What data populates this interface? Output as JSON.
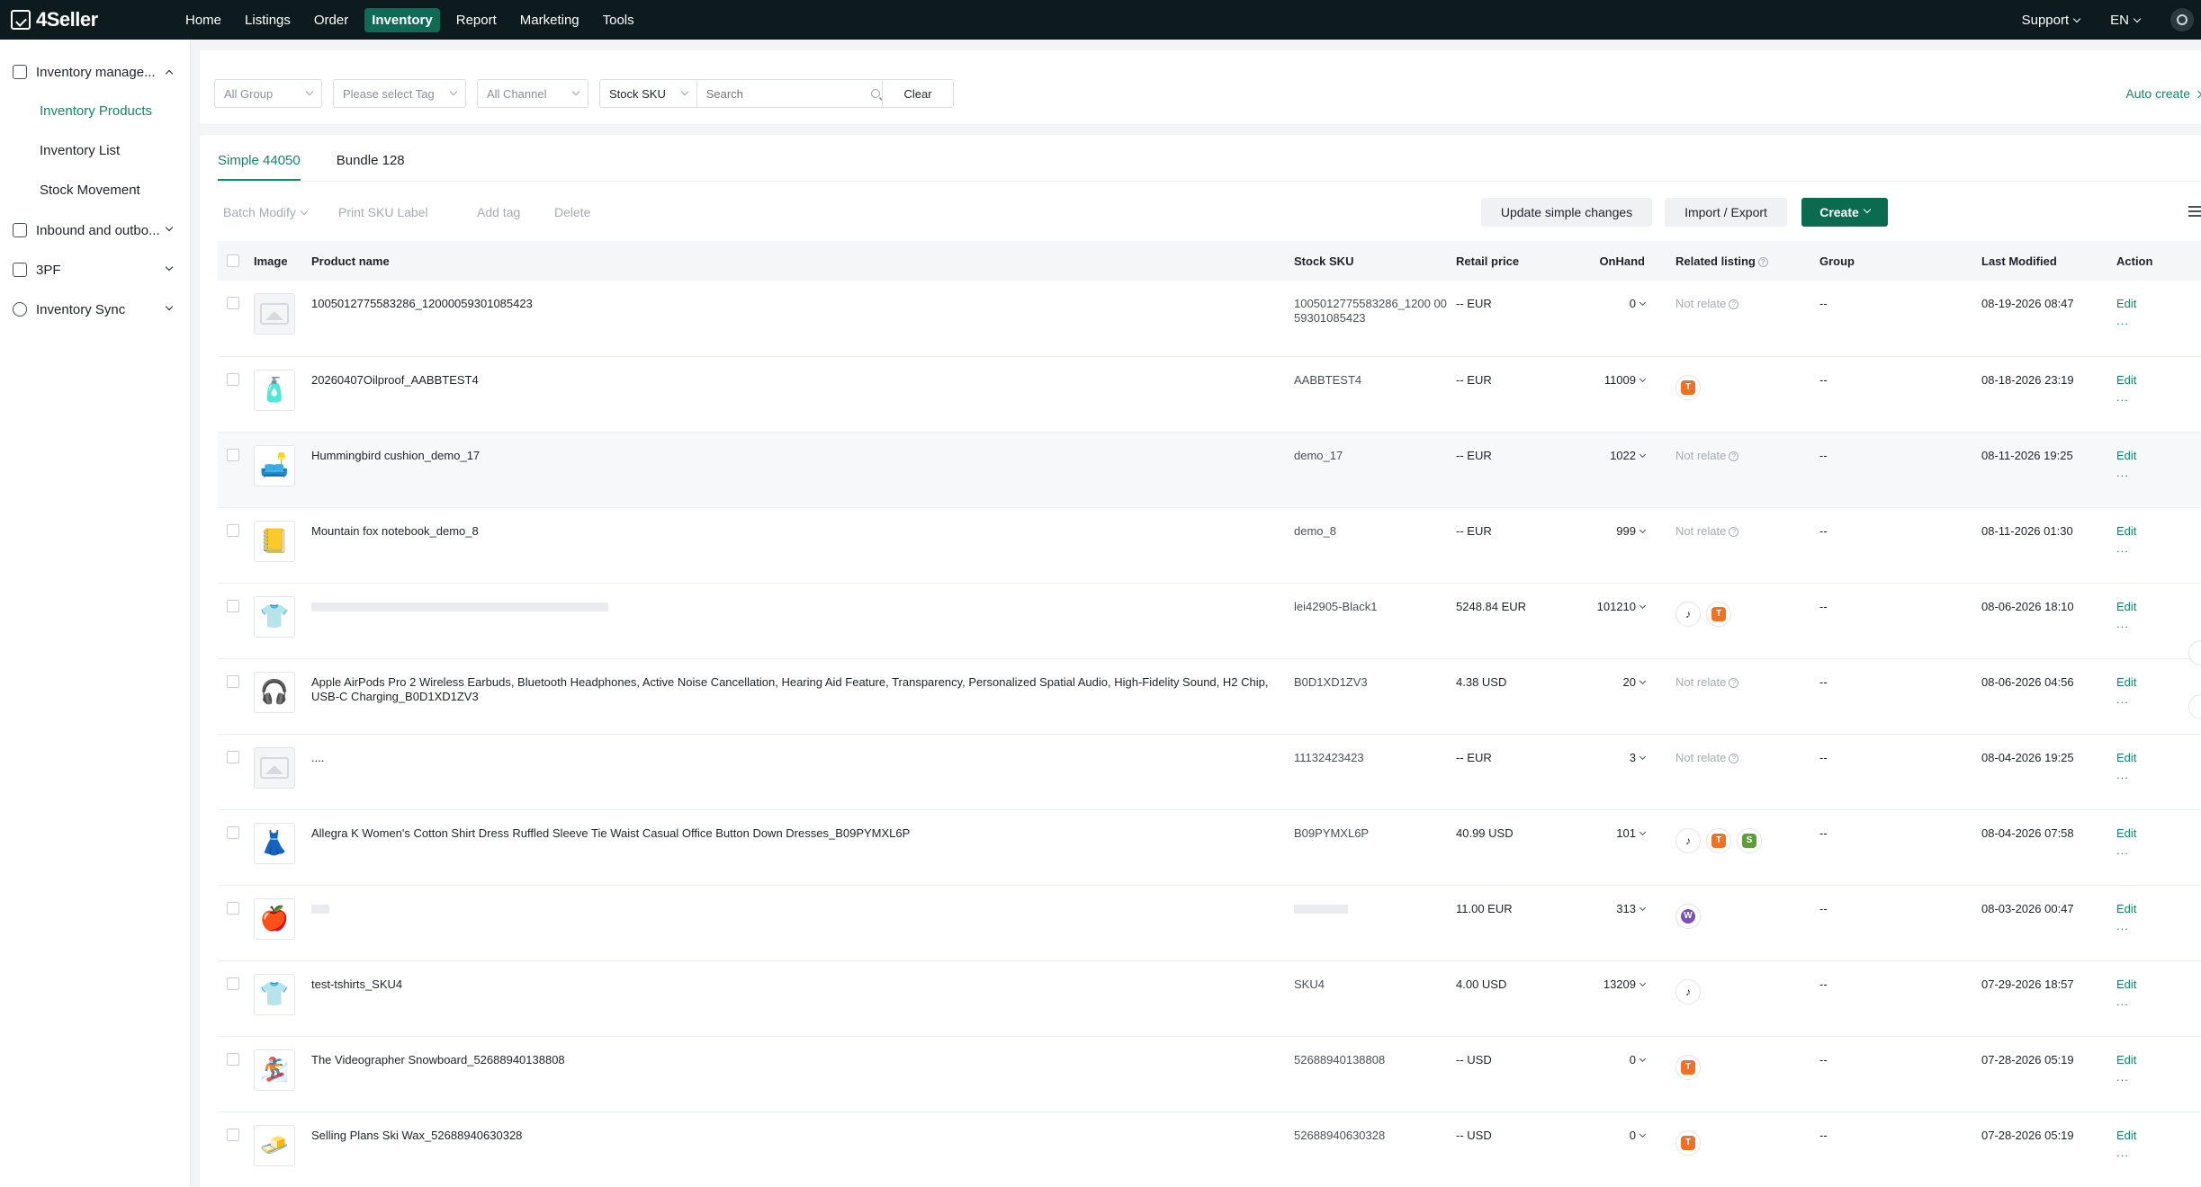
{
  "app": {
    "name": "4Seller"
  },
  "nav": {
    "items": [
      "Home",
      "Listings",
      "Order",
      "Inventory",
      "Report",
      "Marketing",
      "Tools"
    ],
    "active": "Inventory",
    "support": "Support",
    "lang": "EN"
  },
  "sidebar": {
    "groups": [
      {
        "label": "Inventory manage...",
        "expanded": true
      },
      {
        "label": "Inbound and outbo...",
        "expanded": false
      },
      {
        "label": "3PF",
        "expanded": false
      },
      {
        "label": "Inventory Sync",
        "expanded": false
      }
    ],
    "sub_items": [
      "Inventory Products",
      "Inventory List",
      "Stock Movement"
    ],
    "active_sub": "Inventory Products"
  },
  "filters": {
    "group": "All Group",
    "tag": "Please select Tag",
    "channel": "All Channel",
    "search_field": "Stock SKU",
    "search_placeholder": "Search",
    "clear": "Clear",
    "auto_create": "Auto create"
  },
  "tabs": [
    {
      "label": "Simple 44050",
      "active": true
    },
    {
      "label": "Bundle 128",
      "active": false
    }
  ],
  "toolbar": {
    "batch_modify": "Batch Modify",
    "print_sku": "Print SKU Label",
    "add_tag": "Add tag",
    "delete": "Delete",
    "update_simple": "Update simple changes",
    "import_export": "Import / Export",
    "create": "Create"
  },
  "table": {
    "headers": [
      "Image",
      "Product name",
      "Stock SKU",
      "Retail price",
      "OnHand",
      "Related listing",
      "Group",
      "Last Modified",
      "Action"
    ],
    "rows": [
      {
        "image": "placeholder",
        "name": "1005012775583286_12000059301085423",
        "sku": "1005012775583286_1200 0059301085423",
        "price": "-- EUR",
        "onhand": "0",
        "related": "Not relate",
        "channels": [],
        "group": "--",
        "modified": "08-19-2026 08:47",
        "action": "Edit",
        "more": "..."
      },
      {
        "image": "product",
        "name": "20260407Oilproof_AABBTEST4",
        "sku": "AABBTEST4",
        "price": "-- EUR",
        "onhand": "11009",
        "related": "",
        "channels": [
          "temu"
        ],
        "group": "--",
        "modified": "08-18-2026 23:19",
        "action": "Edit",
        "more": "..."
      },
      {
        "image": "cushion",
        "name": "Hummingbird cushion_demo_17",
        "sku": "demo_17",
        "price": "-- EUR",
        "onhand": "1022",
        "related": "Not relate",
        "channels": [],
        "group": "--",
        "modified": "08-11-2026 19:25",
        "action": "Edit",
        "more": "..."
      },
      {
        "image": "notebook",
        "name": "Mountain fox notebook_demo_8",
        "sku": "demo_8",
        "price": "-- EUR",
        "onhand": "999",
        "related": "Not relate",
        "channels": [],
        "group": "--",
        "modified": "08-11-2026 01:30",
        "action": "Edit",
        "more": "..."
      },
      {
        "image": "shirt",
        "name": "",
        "sku": "lei42905-Black1",
        "price": "5248.84 EUR",
        "onhand": "101210",
        "related": "",
        "channels": [
          "tiktok",
          "temu"
        ],
        "group": "--",
        "modified": "08-06-2026 18:10",
        "action": "Edit",
        "more": "..."
      },
      {
        "image": "earbuds",
        "name": "Apple AirPods Pro 2 Wireless Earbuds, Bluetooth Headphones, Active Noise Cancellation, Hearing Aid Feature, Transparency, Personalized Spatial Audio, High-Fidelity Sound, H2 Chip, USB-C Charging_B0D1XD1ZV3",
        "sku": "B0D1XD1ZV3",
        "price": "4.38 USD",
        "onhand": "20",
        "related": "Not relate",
        "channels": [],
        "group": "--",
        "modified": "08-06-2026 04:56",
        "action": "Edit",
        "more": "..."
      },
      {
        "image": "placeholder",
        "name": "....",
        "sku": "11132423423",
        "price": "-- EUR",
        "onhand": "3",
        "related": "Not relate",
        "channels": [],
        "group": "--",
        "modified": "08-04-2026 19:25",
        "action": "Edit",
        "more": "..."
      },
      {
        "image": "dress",
        "name": "Allegra K Women's Cotton Shirt Dress Ruffled Sleeve Tie Waist Casual Office Button Down Dresses_B09PYMXL6P",
        "sku": "B09PYMXL6P",
        "price": "40.99 USD",
        "onhand": "101",
        "related": "",
        "channels": [
          "tiktok",
          "temu",
          "shopify"
        ],
        "group": "--",
        "modified": "08-04-2026 07:58",
        "action": "Edit",
        "more": "..."
      },
      {
        "image": "apple",
        "name": "",
        "sku": "",
        "price": "11.00 EUR",
        "onhand": "313",
        "related": "",
        "channels": [
          "woo"
        ],
        "group": "--",
        "modified": "08-03-2026 00:47",
        "action": "Edit",
        "more": "..."
      },
      {
        "image": "tshirt",
        "name": "test-tshirts_SKU4",
        "sku": "SKU4",
        "price": "4.00 USD",
        "onhand": "13209",
        "related": "",
        "channels": [
          "tiktok"
        ],
        "group": "--",
        "modified": "07-29-2026 18:57",
        "action": "Edit",
        "more": "..."
      },
      {
        "image": "snowboard",
        "name": "The Videographer Snowboard_52688940138808",
        "sku": "52688940138808",
        "price": "-- USD",
        "onhand": "0",
        "related": "",
        "channels": [
          "temu"
        ],
        "group": "--",
        "modified": "07-28-2026 05:19",
        "action": "Edit",
        "more": "..."
      },
      {
        "image": "wax",
        "name": "Selling Plans Ski Wax_52688940630328",
        "sku": "52688940630328",
        "price": "-- USD",
        "onhand": "0",
        "related": "",
        "channels": [
          "temu"
        ],
        "group": "--",
        "modified": "07-28-2026 05:19",
        "action": "Edit",
        "more": "..."
      }
    ]
  },
  "colors": {
    "brand_green": "#0f8a66",
    "topbar": "#0d1b1e",
    "temu": "#f36f21"
  }
}
